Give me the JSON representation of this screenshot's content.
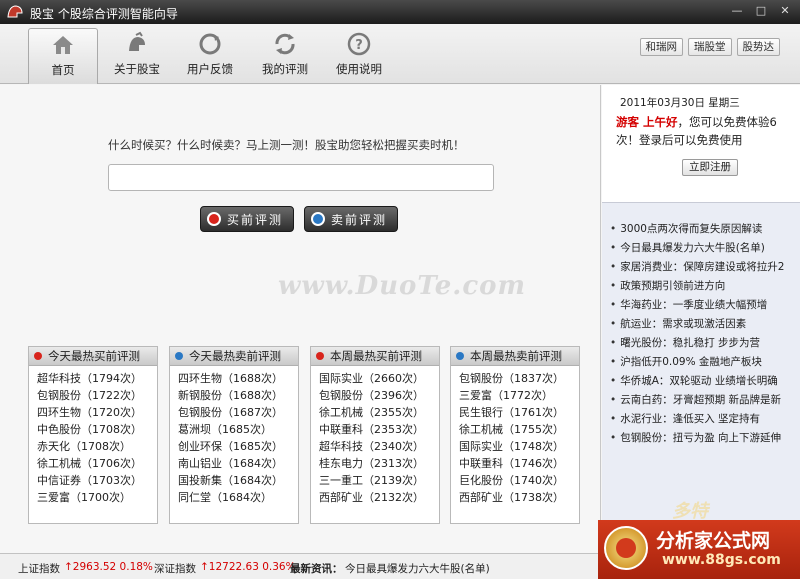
{
  "window": {
    "title": "股宝 个股综合评测智能向导",
    "controls": [
      "—",
      "□",
      "✕"
    ]
  },
  "nav": {
    "items": [
      {
        "label": "首页",
        "icon": "home-icon",
        "active": true
      },
      {
        "label": "关于股宝",
        "icon": "helmet-icon",
        "active": false
      },
      {
        "label": "用户反馈",
        "icon": "feedback-icon",
        "active": false
      },
      {
        "label": "我的评测",
        "icon": "refresh-icon",
        "active": false
      },
      {
        "label": "使用说明",
        "icon": "help-icon",
        "active": false
      }
    ],
    "right_links": [
      "和瑞网",
      "瑞股堂",
      "股势达"
    ]
  },
  "main": {
    "prompt": "什么时候买？什么时候卖？马上测一测！股宝助您轻松把握买卖时机！",
    "search_value": "",
    "buy_button": "买前评测",
    "sell_button": "卖前评测",
    "watermark": "www.DuoTe.com"
  },
  "panels": [
    {
      "title": "今天最热买前评测",
      "dot": "#d8241c",
      "items": [
        "超华科技（1794次）",
        "包钢股份（1722次）",
        "四环生物（1720次）",
        "中色股份（1708次）",
        "赤天化（1708次）",
        "徐工机械（1706次）",
        "中信证券（1703次）",
        "三爱富（1700次）"
      ]
    },
    {
      "title": "今天最热卖前评测",
      "dot": "#2a78c4",
      "items": [
        "四环生物（1688次）",
        "新钢股份（1688次）",
        "包钢股份（1687次）",
        "葛洲坝（1685次）",
        "创业环保（1685次）",
        "南山铝业（1684次）",
        "国投新集（1684次）",
        "同仁堂（1684次）"
      ]
    },
    {
      "title": "本周最热买前评测",
      "dot": "#d8241c",
      "items": [
        "国际实业（2660次）",
        "包钢股份（2396次）",
        "徐工机械（2355次）",
        "中联重科（2353次）",
        "超华科技（2340次）",
        "桂东电力（2313次）",
        "三一重工（2139次）",
        "西部矿业（2132次）"
      ]
    },
    {
      "title": "本周最热卖前评测",
      "dot": "#2a78c4",
      "items": [
        "包钢股份（1837次）",
        "三爱富（1772次）",
        "民生银行（1761次）",
        "徐工机械（1755次）",
        "国际实业（1748次）",
        "中联重科（1746次）",
        "巨化股份（1740次）",
        "西部矿业（1738次）"
      ]
    }
  ],
  "sidebar": {
    "date": "2011年03月30日  星期三",
    "guest_prefix": "游客 上午好",
    "guest_text": "，您可以免费体验6次！登录后可以免费使用",
    "register": "立即注册",
    "news": [
      "3000点两次得而复失原因解读",
      "今日最具爆发力六大牛股(名单)",
      "家居消费业：保障房建设或将拉升2",
      "政策预期引领前进方向",
      "华海药业：一季度业绩大幅预增",
      "航运业：需求或现激活因素",
      "曙光股份：稳扎稳打 步步为营",
      "沪指低开0.09% 金融地产板块",
      "华侨城A：双轮驱动 业绩增长明确",
      "云南白药：牙膏超预期 新品牌是新",
      "水泥行业：逢低买入 坚定持有",
      "包钢股份：扭亏为盈 向上下游延伸"
    ]
  },
  "status": {
    "sh_label": "上证指数",
    "sh_value": "↑2963.52 0.18%",
    "sz_label": "深证指数",
    "sz_value": "↑12722.63 0.36%",
    "news_label": "最新资讯：",
    "news_text": "今日最具爆发力六大牛股(名单)"
  },
  "ad": {
    "line1": "分析家公式网",
    "line2": "www.88gs.com",
    "mark": "多特"
  }
}
